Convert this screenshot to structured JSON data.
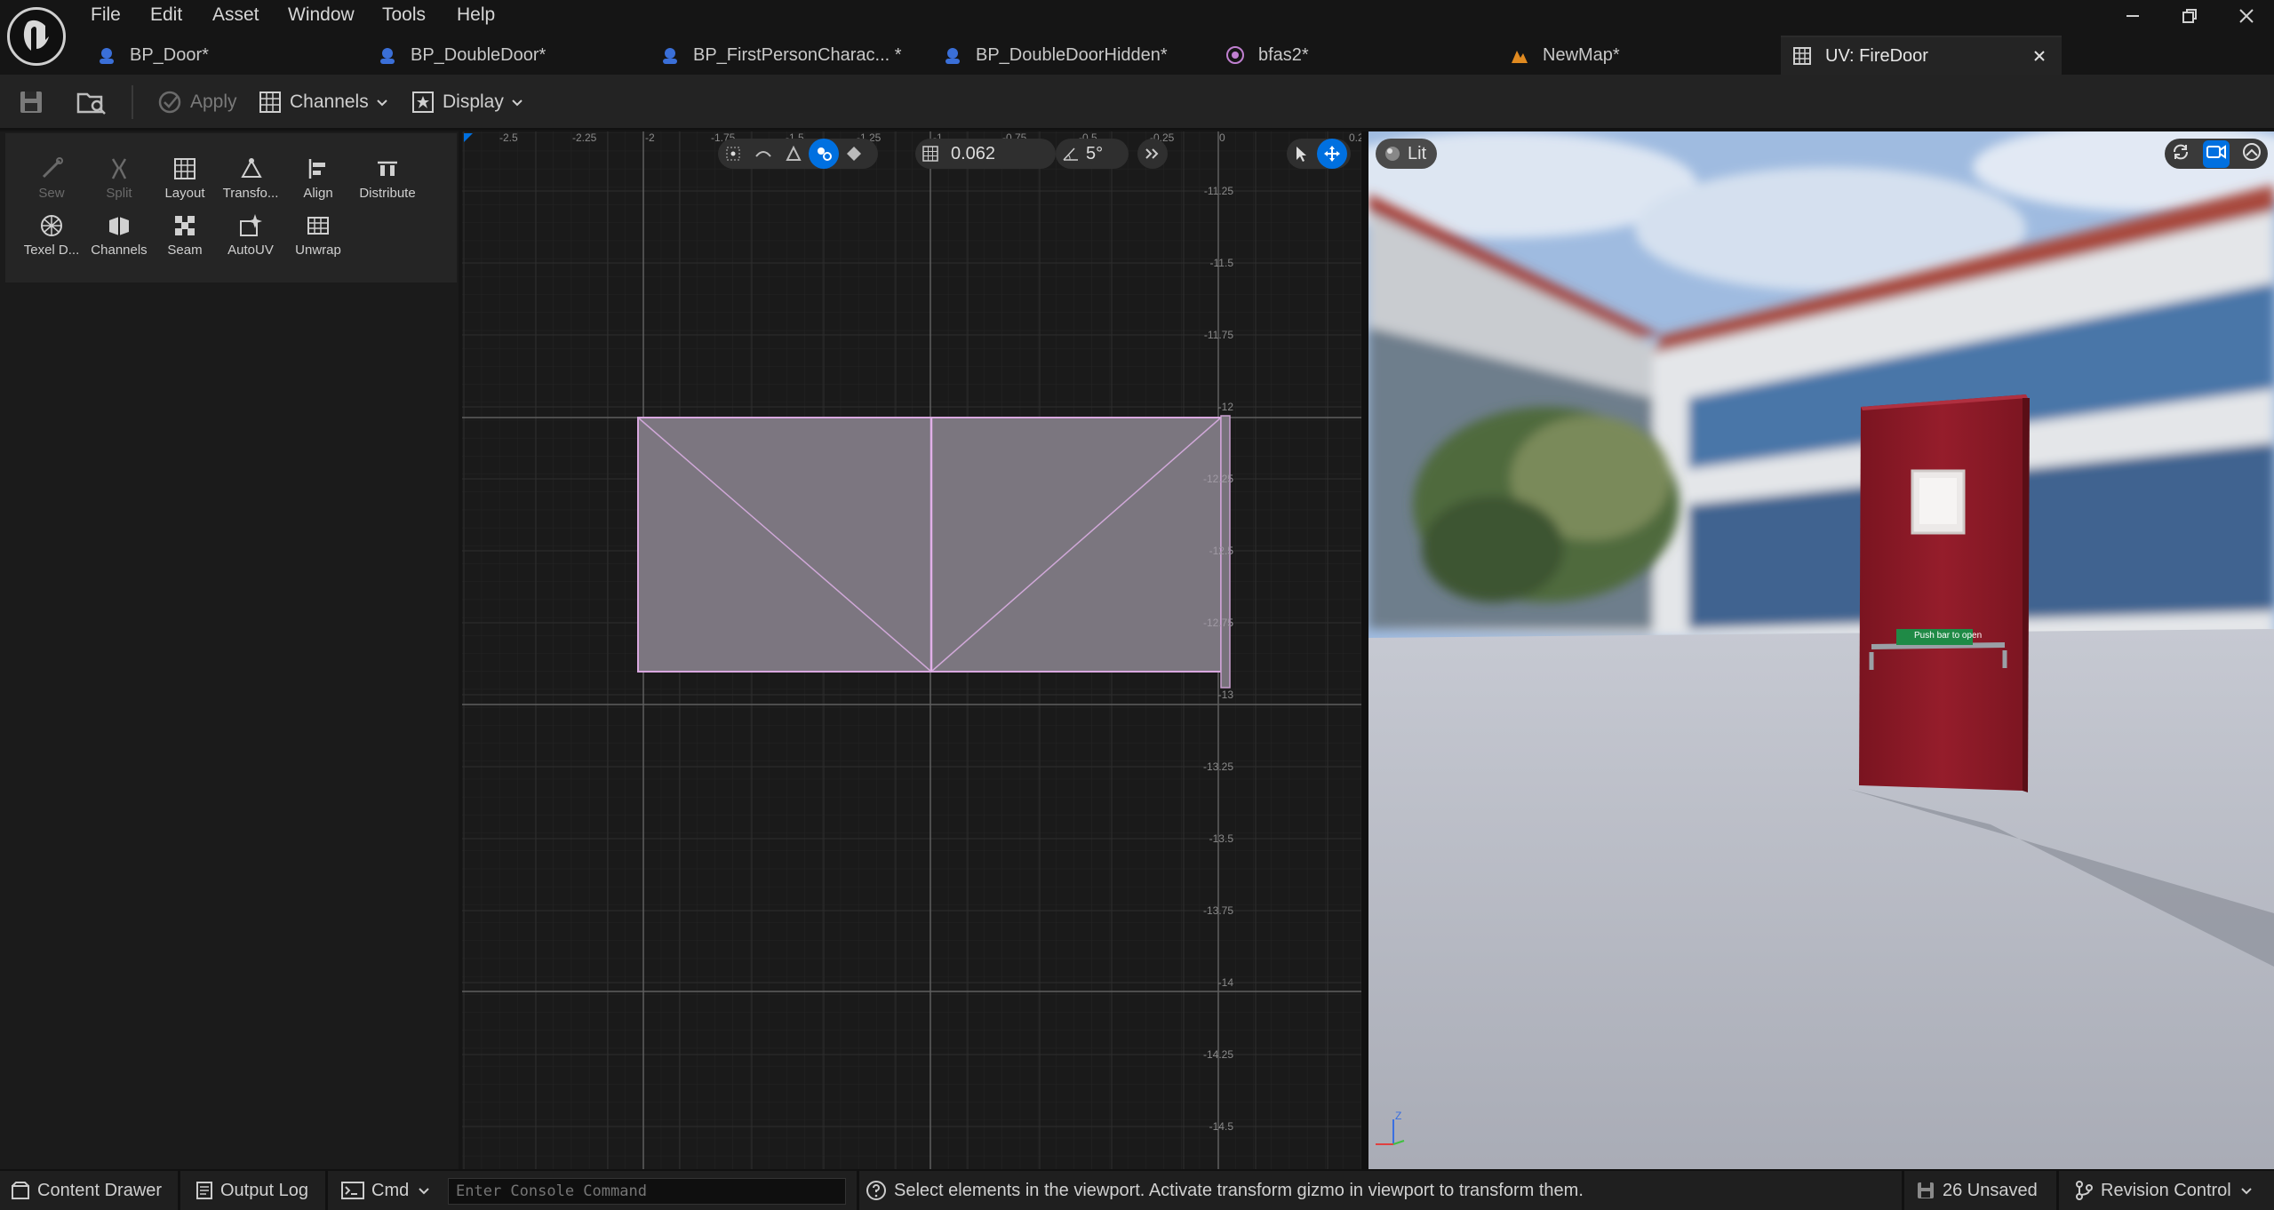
{
  "menu": [
    "File",
    "Edit",
    "Asset",
    "Window",
    "Tools",
    "Help"
  ],
  "tabs": [
    {
      "label": "BP_Door*",
      "icon": "blueprint-icon"
    },
    {
      "label": "BP_DoubleDoor*",
      "icon": "blueprint-icon"
    },
    {
      "label": "BP_FirstPersonCharac... *",
      "icon": "blueprint-icon"
    },
    {
      "label": "BP_DoubleDoorHidden*",
      "icon": "blueprint-icon"
    },
    {
      "label": "bfas2*",
      "icon": "material-icon"
    },
    {
      "label": "NewMap*",
      "icon": "level-icon"
    },
    {
      "label": "UV: FireDoor",
      "icon": "uv-grid-icon",
      "active": true
    }
  ],
  "toolbar": {
    "apply": "Apply",
    "channels": "Channels",
    "display": "Display"
  },
  "tools_row1": [
    "Sew",
    "Split",
    "Layout",
    "Transfo...",
    "Align",
    "Distribute"
  ],
  "tools_row2": [
    "Texel D...",
    "Channels",
    "Seam",
    "AutoUV",
    "Unwrap"
  ],
  "uv_toolbar": {
    "grid_snap": "0.062",
    "angle_snap": "5°"
  },
  "uv_axis": {
    "top": [
      "-2.5",
      "-2.25",
      "-2",
      "-1.75",
      "-1.5",
      "-1.25",
      "-1",
      "-0.75",
      "-0.5",
      "-0.25",
      "0",
      "0.2"
    ],
    "right": [
      "-11.25",
      "-11.5",
      "-11.75",
      "-12",
      "-12.25",
      "-12.5",
      "-12.75",
      "-13",
      "-13.25",
      "-13.5",
      "-13.75",
      "-14",
      "-14.25",
      "-14.5"
    ]
  },
  "viewport": {
    "view_mode": "Lit",
    "door_sign": "Push bar to open"
  },
  "statusbar": {
    "content_drawer": "Content Drawer",
    "output_log": "Output Log",
    "cmd": "Cmd",
    "console_placeholder": "Enter Console Command",
    "message": "Select elements in the viewport. Activate transform gizmo in viewport to transform them.",
    "unsaved": "26 Unsaved",
    "revision_control": "Revision Control"
  },
  "colors": {
    "accent": "#0070e0",
    "uv_edge": "#d9a8e0",
    "door": "#8a1b28"
  }
}
